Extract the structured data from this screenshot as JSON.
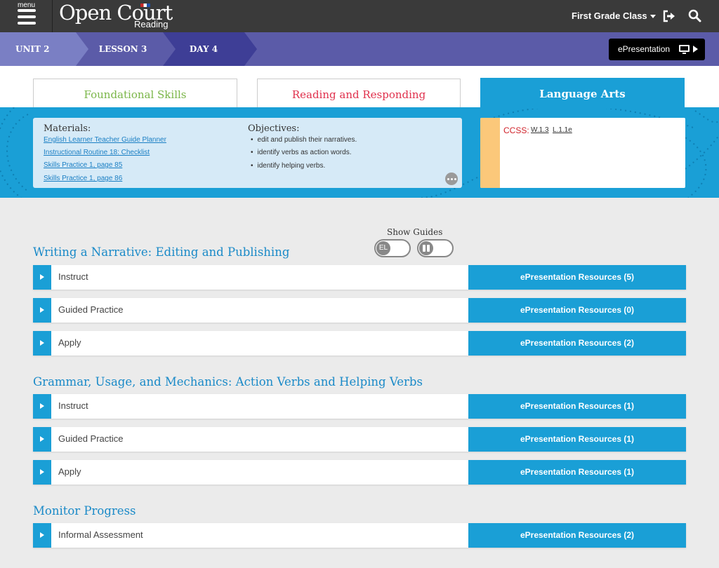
{
  "header": {
    "menu_label": "menu",
    "logo_main": "Open Court",
    "logo_sub": "Reading",
    "class_select": "First Grade Class"
  },
  "breadcrumb": {
    "unit": "UNIT 2",
    "lesson": "LESSON 3",
    "day": "DAY 4",
    "epresentation_label": "ePresentation"
  },
  "tabs": [
    {
      "label": "Foundational Skills",
      "color": "#7ab648"
    },
    {
      "label": "Reading and Responding",
      "color": "#e0304c"
    },
    {
      "label": "Language Arts",
      "color": "#1a9fd6",
      "active": true
    }
  ],
  "info": {
    "materials_title": "Materials:",
    "materials": [
      "English Learner Teacher Guide Planner",
      "Instructional Routine 18: Checklist",
      "Skills Practice 1, page 85",
      "Skills Practice 1, page 86"
    ],
    "objectives_title": "Objectives:",
    "objectives": [
      "edit and publish their narratives.",
      "identify verbs as action words.",
      "identify helping verbs."
    ],
    "ccss_label": "CCSS:",
    "ccss_codes": [
      "W.1.3",
      "L.1.1e"
    ]
  },
  "guides": {
    "label": "Show Guides",
    "el_label": "EL"
  },
  "sections": [
    {
      "title": "Writing a Narrative: Editing and Publishing",
      "rows": [
        {
          "label": "Instruct",
          "resources": "ePresentation Resources (5)"
        },
        {
          "label": "Guided Practice",
          "resources": "ePresentation Resources (0)"
        },
        {
          "label": "Apply",
          "resources": "ePresentation Resources (2)"
        }
      ]
    },
    {
      "title": "Grammar, Usage, and Mechanics: Action Verbs and Helping Verbs",
      "rows": [
        {
          "label": "Instruct",
          "resources": "ePresentation Resources (1)"
        },
        {
          "label": "Guided Practice",
          "resources": "ePresentation Resources (1)"
        },
        {
          "label": "Apply",
          "resources": "ePresentation Resources (1)"
        }
      ]
    },
    {
      "title": "Monitor Progress",
      "rows": [
        {
          "label": "Informal Assessment",
          "resources": "ePresentation Resources (2)"
        }
      ]
    }
  ]
}
